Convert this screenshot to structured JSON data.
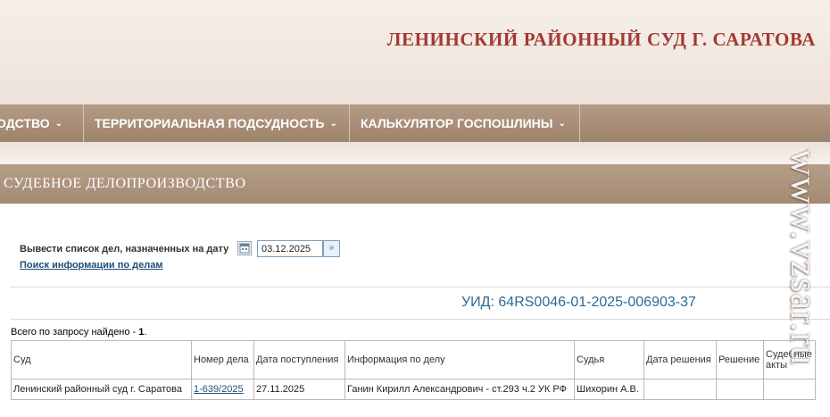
{
  "header": {
    "court_title": "ЛЕНИНСКИЙ РАЙОННЫЙ СУД Г. САРАТОВА"
  },
  "nav": {
    "items": [
      {
        "label": "ОДСТВО"
      },
      {
        "label": "ТЕРРИТОРИАЛЬНАЯ ПОДСУДНОСТЬ"
      },
      {
        "label": "КАЛЬКУЛЯТОР ГОСПОШЛИНЫ"
      }
    ],
    "chevron": "⌄"
  },
  "section": {
    "title": "СУДЕБНОЕ ДЕЛОПРОИЗВОДСТВО"
  },
  "filter": {
    "date_label": "Вывести список дел, назначенных на дату",
    "date_value": "03.12.2025",
    "search_link": "Поиск информации по делам",
    "go_symbol": "»"
  },
  "uid": "УИД: 64RS0046-01-2025-006903-37",
  "results": {
    "prefix": "Всего по запросу найдено - ",
    "count": "1",
    "suffix": "."
  },
  "table": {
    "columns": [
      "Суд",
      "Номер дела",
      "Дата поступления",
      "Информация по делу",
      "Судья",
      "Дата решения",
      "Решение",
      "Судебные акты"
    ],
    "rows": [
      {
        "court": "Ленинский районный суд г. Саратова",
        "case_number": "1-639/2025",
        "received": "27.11.2025",
        "info": "Ганин Кирилл Александрович - ст.293 ч.2 УК РФ",
        "judge": "Шихорин А.В.",
        "decision_date": "",
        "decision": "",
        "acts": ""
      }
    ]
  },
  "watermark": "www.vzsar.ru",
  "colors": {
    "title_red": "#a33a32",
    "nav_brown": "#a48a73",
    "link_blue": "#1d4e7a",
    "uid_blue": "#2c6a96"
  }
}
